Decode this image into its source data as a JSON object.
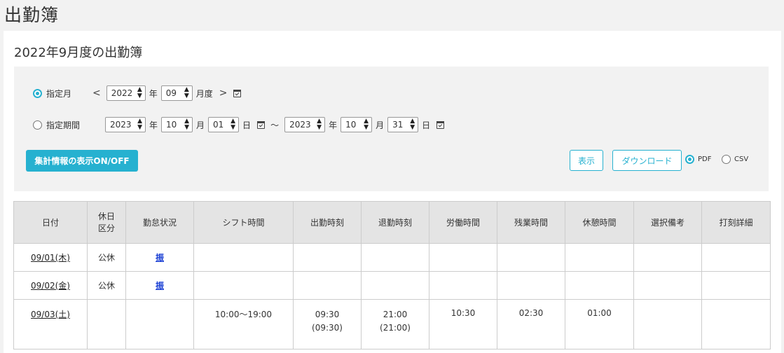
{
  "page": {
    "title": "出勤簿"
  },
  "card": {
    "title": "2022年9月度の出勤簿"
  },
  "filter": {
    "month_mode": {
      "label": "指定月",
      "year": "2022",
      "year_unit": "年",
      "month": "09",
      "month_unit": "月度",
      "prev": "<",
      "next": ">"
    },
    "period_mode": {
      "label": "指定期間",
      "start_year": "2023",
      "start_month": "10",
      "start_day": "01",
      "end_year": "2023",
      "end_month": "10",
      "end_day": "31",
      "year_unit": "年",
      "month_unit": "月",
      "day_unit": "日",
      "range_sep": "〜"
    },
    "summary_toggle_label": "集計情報の表示ON/OFF",
    "show_label": "表示",
    "download_label": "ダウンロード",
    "format_pdf": "PDF",
    "format_csv": "CSV"
  },
  "table": {
    "headers": [
      "日付",
      "休日区分",
      "勤怠状況",
      "シフト時間",
      "出勤時刻",
      "退勤時刻",
      "労働時間",
      "残業時間",
      "休憩時間",
      "選択備考",
      "打刻詳細"
    ],
    "rows": [
      {
        "date": "09/01(木)",
        "holiday": "公休",
        "status": "振",
        "shift": "",
        "in": "",
        "in_sub": "",
        "out": "",
        "out_sub": "",
        "work": "",
        "overtime": "",
        "break": "",
        "note": "",
        "detail": ""
      },
      {
        "date": "09/02(金)",
        "holiday": "公休",
        "status": "振",
        "shift": "",
        "in": "",
        "in_sub": "",
        "out": "",
        "out_sub": "",
        "work": "",
        "overtime": "",
        "break": "",
        "note": "",
        "detail": ""
      },
      {
        "date": "09/03(土)",
        "holiday": "",
        "status": "",
        "shift": "10:00〜19:00",
        "in": "09:30",
        "in_sub": "(09:30)",
        "out": "21:00",
        "out_sub": "(21:00)",
        "work": "10:30",
        "overtime": "02:30",
        "break": "01:00",
        "note": "",
        "detail": ""
      }
    ]
  },
  "colors": {
    "accent": "#26b1d0",
    "link_blue": "#1a3fd4",
    "header_bg": "#e4e4e4",
    "filter_bg": "#f2f2f2"
  }
}
